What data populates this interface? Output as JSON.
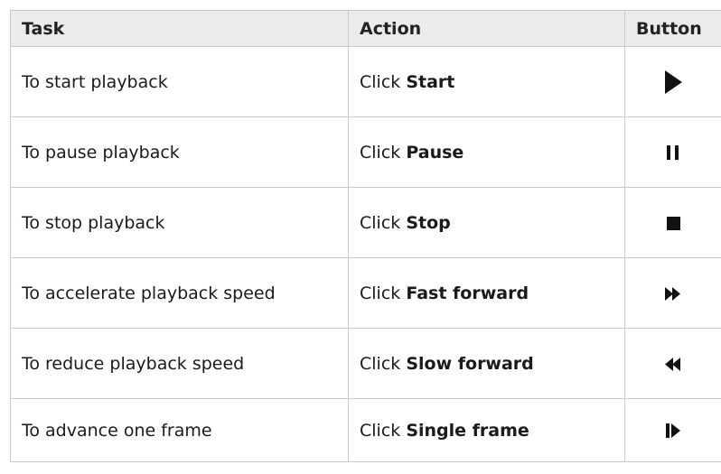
{
  "table": {
    "headers": {
      "task": "Task",
      "action": "Action",
      "button": "Button"
    },
    "rows": [
      {
        "task": "To start playback",
        "action_prefix": "Click",
        "action_bold": "Start",
        "icon": "play-icon"
      },
      {
        "task": "To pause playback",
        "action_prefix": "Click",
        "action_bold": "Pause",
        "icon": "pause-icon"
      },
      {
        "task": "To stop playback",
        "action_prefix": "Click",
        "action_bold": "Stop",
        "icon": "stop-icon"
      },
      {
        "task": "To accelerate playback speed",
        "action_prefix": "Click",
        "action_bold": "Fast forward",
        "icon": "fast-forward-icon"
      },
      {
        "task": "To reduce playback speed",
        "action_prefix": "Click",
        "action_bold": "Slow forward",
        "icon": "rewind-icon"
      },
      {
        "task": "To advance one frame",
        "action_prefix": "Click",
        "action_bold": "Single frame",
        "icon": "single-frame-icon"
      }
    ]
  },
  "colors": {
    "header_bg": "#ebebeb",
    "border": "#c9c9c9",
    "icon": "#111111"
  }
}
